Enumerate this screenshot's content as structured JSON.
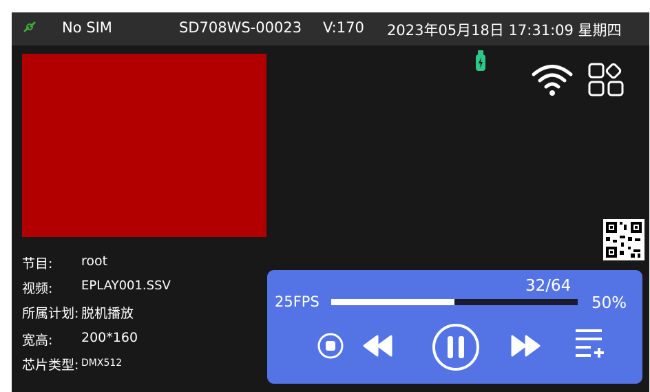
{
  "status_bar": {
    "sim_status": "No SIM",
    "device_id": "SD708WS-00023",
    "version": "V:170",
    "datetime": "2023年05月18日 17:31:09 星期四"
  },
  "icons": {
    "link": "link-icon",
    "usb": "usb-icon",
    "wifi": "wifi-icon",
    "apps": "apps-grid-icon",
    "qr": "qr-code-icon"
  },
  "preview": {
    "color": "#b20000"
  },
  "info": [
    {
      "key": "节目:",
      "value": "root"
    },
    {
      "key": "视频:",
      "value": "EPLAY001.SSV"
    },
    {
      "key": "所属计划:",
      "value": "脱机播放"
    },
    {
      "key": "宽高:",
      "value": "200*160"
    },
    {
      "key": "芯片类型:",
      "value": "DMX512"
    }
  ],
  "player": {
    "fps": "25FPS",
    "counter": "32/64",
    "percent": "50%",
    "progress": 0.5,
    "controls": [
      "stop-button",
      "rewind-button",
      "pause-button",
      "fast-forward-button",
      "playlist-add-button"
    ]
  },
  "colors": {
    "background": "#181818",
    "status_bar": "#2e2e2e",
    "player_panel": "#5474e6",
    "link_icon": "#3caa3c",
    "usb_icon": "#2ec78a"
  }
}
